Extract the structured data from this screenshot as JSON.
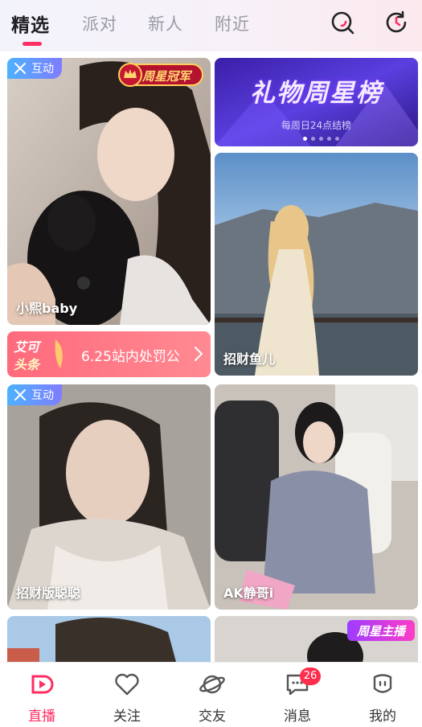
{
  "tabs": [
    {
      "label": "精选",
      "active": true
    },
    {
      "label": "派对",
      "active": false
    },
    {
      "label": "新人",
      "active": false
    },
    {
      "label": "附近",
      "active": false
    }
  ],
  "header_icons": [
    "search-icon",
    "history-icon"
  ],
  "cards": {
    "card1": {
      "name": "小熙baby",
      "badge": "互动",
      "crown": "周星冠军"
    },
    "card2": {
      "name": "招财鱼儿"
    },
    "card3": {
      "name": "招财版聪聪",
      "badge": "互动"
    },
    "card4": {
      "name": "AK静哥i"
    },
    "card6": {
      "badge": "周星主播"
    }
  },
  "banner": {
    "title": "礼物周星榜",
    "subtitle": "每周日24点结榜",
    "dots": 5,
    "active_dot": 0
  },
  "news": {
    "logo_line1": "艾可",
    "logo_line2": "头条",
    "text": "6.25站内处罚公"
  },
  "bottom_nav": [
    {
      "label": "直播",
      "icon": "live-icon",
      "active": true
    },
    {
      "label": "关注",
      "icon": "heart-icon",
      "active": false
    },
    {
      "label": "交友",
      "icon": "planet-icon",
      "active": false
    },
    {
      "label": "消息",
      "icon": "message-icon",
      "active": false,
      "badge": "26"
    },
    {
      "label": "我的",
      "icon": "profile-icon",
      "active": false
    }
  ],
  "colors": {
    "accent": "#ff2e63",
    "inactive_tab": "#9a9aa3",
    "interact_badge": "#4db1ff"
  }
}
